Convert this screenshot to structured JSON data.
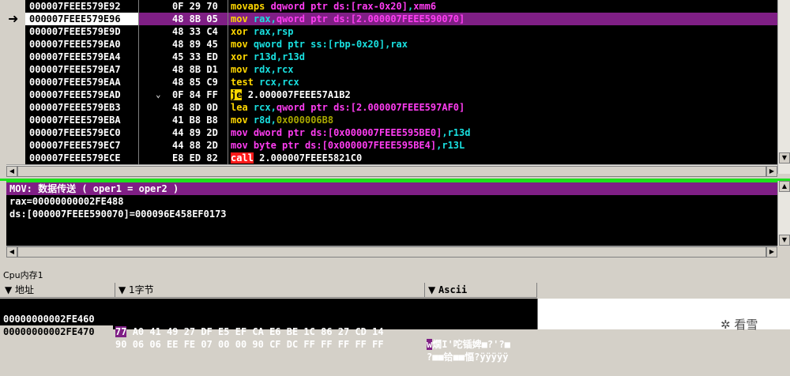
{
  "colors": {
    "address": "#ffffff",
    "bytes": "#ffffff",
    "mnemonic_default": "#ffd700",
    "mnemonic_data": "#ff3df2",
    "operand_register": "#19e0e0",
    "operand_memory": "#ff3df2",
    "operand_immediate": "#a8a800",
    "jump_badge_bg": "#ffd700",
    "call_badge_bg": "#ff1a1a",
    "current_row_bg": "#7f1f85",
    "pane_border": "#1de01d"
  },
  "disasm": {
    "current_marker": "➜",
    "rows": [
      {
        "addr": "000007FEEE579E92",
        "bytes": "0F 29 70",
        "mnem": "movaps",
        "ops": [
          {
            "t": "dqword ptr ds:[rax-0x20]",
            "c": "mem"
          },
          {
            "t": ",",
            "c": "sep"
          },
          {
            "t": "xmm6",
            "c": "mem"
          }
        ]
      },
      {
        "addr": "000007FEEE579E96",
        "bytes": "48 8B 05",
        "mnem": "mov",
        "ops": [
          {
            "t": "rax",
            "c": "reg"
          },
          {
            "t": ",",
            "c": "sep"
          },
          {
            "t": "qword ptr ds:[2.000007FEEE590070]",
            "c": "mem"
          }
        ],
        "current": true
      },
      {
        "addr": "000007FEEE579E9D",
        "bytes": "48 33 C4",
        "mnem": "xor",
        "ops": [
          {
            "t": "rax",
            "c": "reg"
          },
          {
            "t": ",",
            "c": "sep"
          },
          {
            "t": "rsp",
            "c": "reg"
          }
        ]
      },
      {
        "addr": "000007FEEE579EA0",
        "bytes": "48 89 45",
        "mnem": "mov",
        "ops": [
          {
            "t": "qword ptr ss:[rbp-0x20]",
            "c": "reg"
          },
          {
            "t": ",",
            "c": "sep"
          },
          {
            "t": "rax",
            "c": "reg"
          }
        ]
      },
      {
        "addr": "000007FEEE579EA4",
        "bytes": "45 33 ED",
        "mnem": "xor",
        "ops": [
          {
            "t": "r13d",
            "c": "reg"
          },
          {
            "t": ",",
            "c": "sep"
          },
          {
            "t": "r13d",
            "c": "reg"
          }
        ]
      },
      {
        "addr": "000007FEEE579EA7",
        "bytes": "48 8B D1",
        "mnem": "mov",
        "ops": [
          {
            "t": "rdx",
            "c": "reg"
          },
          {
            "t": ",",
            "c": "sep"
          },
          {
            "t": "rcx",
            "c": "reg"
          }
        ]
      },
      {
        "addr": "000007FEEE579EAA",
        "bytes": "48 85 C9",
        "mnem": "test",
        "ops": [
          {
            "t": "rcx",
            "c": "reg"
          },
          {
            "t": ",",
            "c": "sep"
          },
          {
            "t": "rcx",
            "c": "reg"
          }
        ]
      },
      {
        "addr": "000007FEEE579EAD",
        "bytes": "0F 84 FF",
        "mnem": "je",
        "badge": "jump",
        "marker": "⌄",
        "ops": [
          {
            "t": "2.000007FEEE57A1B2",
            "c": "plain"
          }
        ]
      },
      {
        "addr": "000007FEEE579EB3",
        "bytes": "48 8D 0D",
        "mnem": "lea",
        "ops": [
          {
            "t": "rcx",
            "c": "reg"
          },
          {
            "t": ",",
            "c": "sep"
          },
          {
            "t": "qword ptr ds:[2.000007FEEE597AF0]",
            "c": "mem"
          }
        ]
      },
      {
        "addr": "000007FEEE579EBA",
        "bytes": "41 B8 B8",
        "mnem": "mov",
        "ops": [
          {
            "t": "r8d",
            "c": "reg"
          },
          {
            "t": ",",
            "c": "sep"
          },
          {
            "t": "0x000006B8",
            "c": "imm"
          }
        ]
      },
      {
        "addr": "000007FEEE579EC0",
        "bytes": "44 89 2D",
        "mnem": "mov",
        "mnemc": "data",
        "ops": [
          {
            "t": "dword ptr ds:[0x000007FEEE595BE0]",
            "c": "mem"
          },
          {
            "t": ",",
            "c": "sep"
          },
          {
            "t": "r13d",
            "c": "reg"
          }
        ]
      },
      {
        "addr": "000007FEEE579EC7",
        "bytes": "44 88 2D",
        "mnem": "mov",
        "mnemc": "data",
        "ops": [
          {
            "t": "byte ptr ds:[0x000007FEEE595BE4]",
            "c": "mem"
          },
          {
            "t": ",",
            "c": "sep"
          },
          {
            "t": "r13L",
            "c": "reg"
          }
        ]
      },
      {
        "addr": "000007FEEE579ECE",
        "bytes": "E8 ED 82",
        "mnem": "call",
        "badge": "call",
        "ops": [
          {
            "t": "2.000007FEEE5821C0",
            "c": "plain"
          }
        ]
      }
    ]
  },
  "info": {
    "header": "MOV: 数据传送 ( oper1 = oper2 )",
    "lines": [
      "rax=00000000002FE488",
      "ds:[000007FEEE590070]=000096E458EF0173"
    ]
  },
  "dump": {
    "title": "Cpu内存1",
    "col_address_label": "地址",
    "col_hex_label": "1字节",
    "col_ascii_label": "Ascii",
    "rows": [
      {
        "addr": "00000000002FE460",
        "hex_first": "77",
        "hex_rest": "A0 41 49 27 DF E5 EF CA E6 BE 1C 86 27 CD 14",
        "ascii_first": "w",
        "ascii_rest": "燗I'咜锸婢■?'?■",
        "hl_addr": false
      },
      {
        "addr": "00000000002FE470",
        "hex_first": "90",
        "hex_rest": "06 06 EE FE 07 00 00 90 CF DC FF FF FF FF FF",
        "ascii_first": "?",
        "ascii_rest": "■■铪■■愊?ÿÿÿÿÿ",
        "hl_addr": true
      }
    ]
  },
  "watermark": "看雪"
}
